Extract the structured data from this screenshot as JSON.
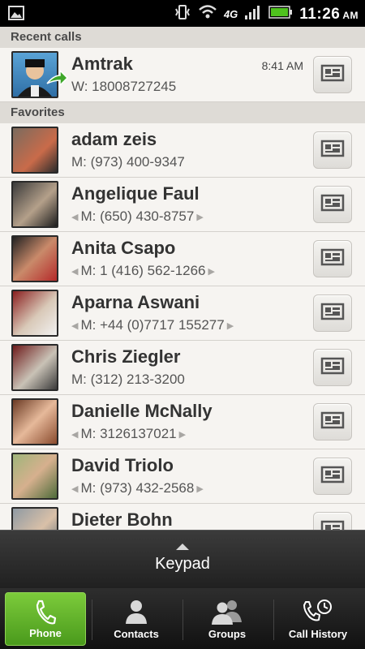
{
  "status_bar": {
    "network": "4G",
    "time": "11:26",
    "ampm": "AM"
  },
  "recent_calls": {
    "header": "Recent calls",
    "items": [
      {
        "name": "Amtrak",
        "detail": "W: 18008727245",
        "time": "8:41 AM"
      }
    ]
  },
  "favorites": {
    "header": "Favorites",
    "items": [
      {
        "name": "adam zeis",
        "detail": "M: (973) 400-9347",
        "arrows": false
      },
      {
        "name": "Angelique Faul",
        "detail": "M: (650) 430-8757",
        "arrows": true
      },
      {
        "name": "Anita Csapo",
        "detail": "M: 1 (416) 562-1266",
        "arrows": true
      },
      {
        "name": "Aparna Aswani",
        "detail": "M: +44 (0)7717 155277",
        "arrows": true
      },
      {
        "name": "Chris Ziegler",
        "detail": "M: (312) 213-3200",
        "arrows": false
      },
      {
        "name": "Danielle McNally",
        "detail": "M: 3126137021",
        "arrows": true
      },
      {
        "name": "David Triolo",
        "detail": "M: (973) 432-2568",
        "arrows": true
      },
      {
        "name": "Dieter Bohn",
        "detail": "",
        "arrows": false
      }
    ]
  },
  "keypad": {
    "label": "Keypad"
  },
  "tabs": [
    {
      "label": "Phone",
      "icon": "phone-icon",
      "active": true
    },
    {
      "label": "Contacts",
      "icon": "person-icon",
      "active": false
    },
    {
      "label": "Groups",
      "icon": "group-icon",
      "active": false
    },
    {
      "label": "Call History",
      "icon": "call-history-icon",
      "active": false
    }
  ],
  "colors": {
    "active_tab": "#5bb028",
    "call_arrow": "#3fa72a"
  }
}
